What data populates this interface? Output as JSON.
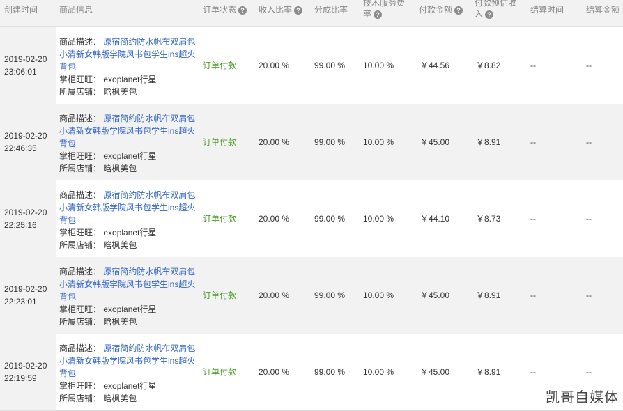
{
  "header": {
    "created_time": "创建时间",
    "product_info": "商品信息",
    "order_status": "订单状态",
    "income_ratio": "收入比率",
    "share_ratio": "分成比率",
    "service_fee_line1": "技术服务费",
    "service_fee_line2": "率",
    "payment_amount": "付款金额",
    "estimated_income_line1": "付款预估收",
    "estimated_income_line2": "入",
    "settle_time": "结算时间",
    "settle_amount": "结算金额"
  },
  "labels": {
    "desc": "商品描述：",
    "seller": "掌柜旺旺：",
    "shop": "所属店铺："
  },
  "rows": [
    {
      "date": "2019-02-20",
      "time": "23:06:01",
      "desc_line1": "原宿简约防水帆布双肩包",
      "desc_line2": "小清新女韩版学院风书包学生ins超火",
      "desc_line3": "背包",
      "seller": "exoplanet行星",
      "shop": "晗枫美包",
      "status": "订单付款",
      "income_ratio": "20.00 %",
      "share_ratio": "99.00 %",
      "fee_ratio": "10.00 %",
      "payment": "￥44.56",
      "estimate": "￥8.82",
      "settle_time": "--",
      "settle_amount": "--"
    },
    {
      "date": "2019-02-20",
      "time": "22:46:35",
      "desc_line1": "原宿简约防水帆布双肩包",
      "desc_line2": "小清新女韩版学院风书包学生ins超火",
      "desc_line3": "背包",
      "seller": "exoplanet行星",
      "shop": "晗枫美包",
      "status": "订单付款",
      "income_ratio": "20.00 %",
      "share_ratio": "99.00 %",
      "fee_ratio": "10.00 %",
      "payment": "￥45.00",
      "estimate": "￥8.91",
      "settle_time": "--",
      "settle_amount": "--"
    },
    {
      "date": "2019-02-20",
      "time": "22:25:16",
      "desc_line1": "原宿简约防水帆布双肩包",
      "desc_line2": "小清新女韩版学院风书包学生ins超火",
      "desc_line3": "背包",
      "seller": "exoplanet行星",
      "shop": "晗枫美包",
      "status": "订单付款",
      "income_ratio": "20.00 %",
      "share_ratio": "99.00 %",
      "fee_ratio": "10.00 %",
      "payment": "￥44.10",
      "estimate": "￥8.73",
      "settle_time": "--",
      "settle_amount": "--"
    },
    {
      "date": "2019-02-20",
      "time": "22:23:01",
      "desc_line1": "原宿简约防水帆布双肩包",
      "desc_line2": "小清新女韩版学院风书包学生ins超火",
      "desc_line3": "背包",
      "seller": "exoplanet行星",
      "shop": "晗枫美包",
      "status": "订单付款",
      "income_ratio": "20.00 %",
      "share_ratio": "99.00 %",
      "fee_ratio": "10.00 %",
      "payment": "￥45.00",
      "estimate": "￥8.91",
      "settle_time": "--",
      "settle_amount": "--"
    },
    {
      "date": "2019-02-20",
      "time": "22:19:59",
      "desc_line1": "原宿简约防水帆布双肩包",
      "desc_line2": "小清新女韩版学院风书包学生ins超火",
      "desc_line3": "背包",
      "seller": "exoplanet行星",
      "shop": "晗枫美包",
      "status": "订单付款",
      "income_ratio": "20.00 %",
      "share_ratio": "99.00 %",
      "fee_ratio": "10.00 %",
      "payment": "￥45.00",
      "estimate": "￥8.91",
      "settle_time": "--",
      "settle_amount": "--"
    }
  ],
  "icons": {
    "help": "question-circle-icon"
  },
  "help_glyph": "?",
  "watermark": "凯哥自媒体"
}
